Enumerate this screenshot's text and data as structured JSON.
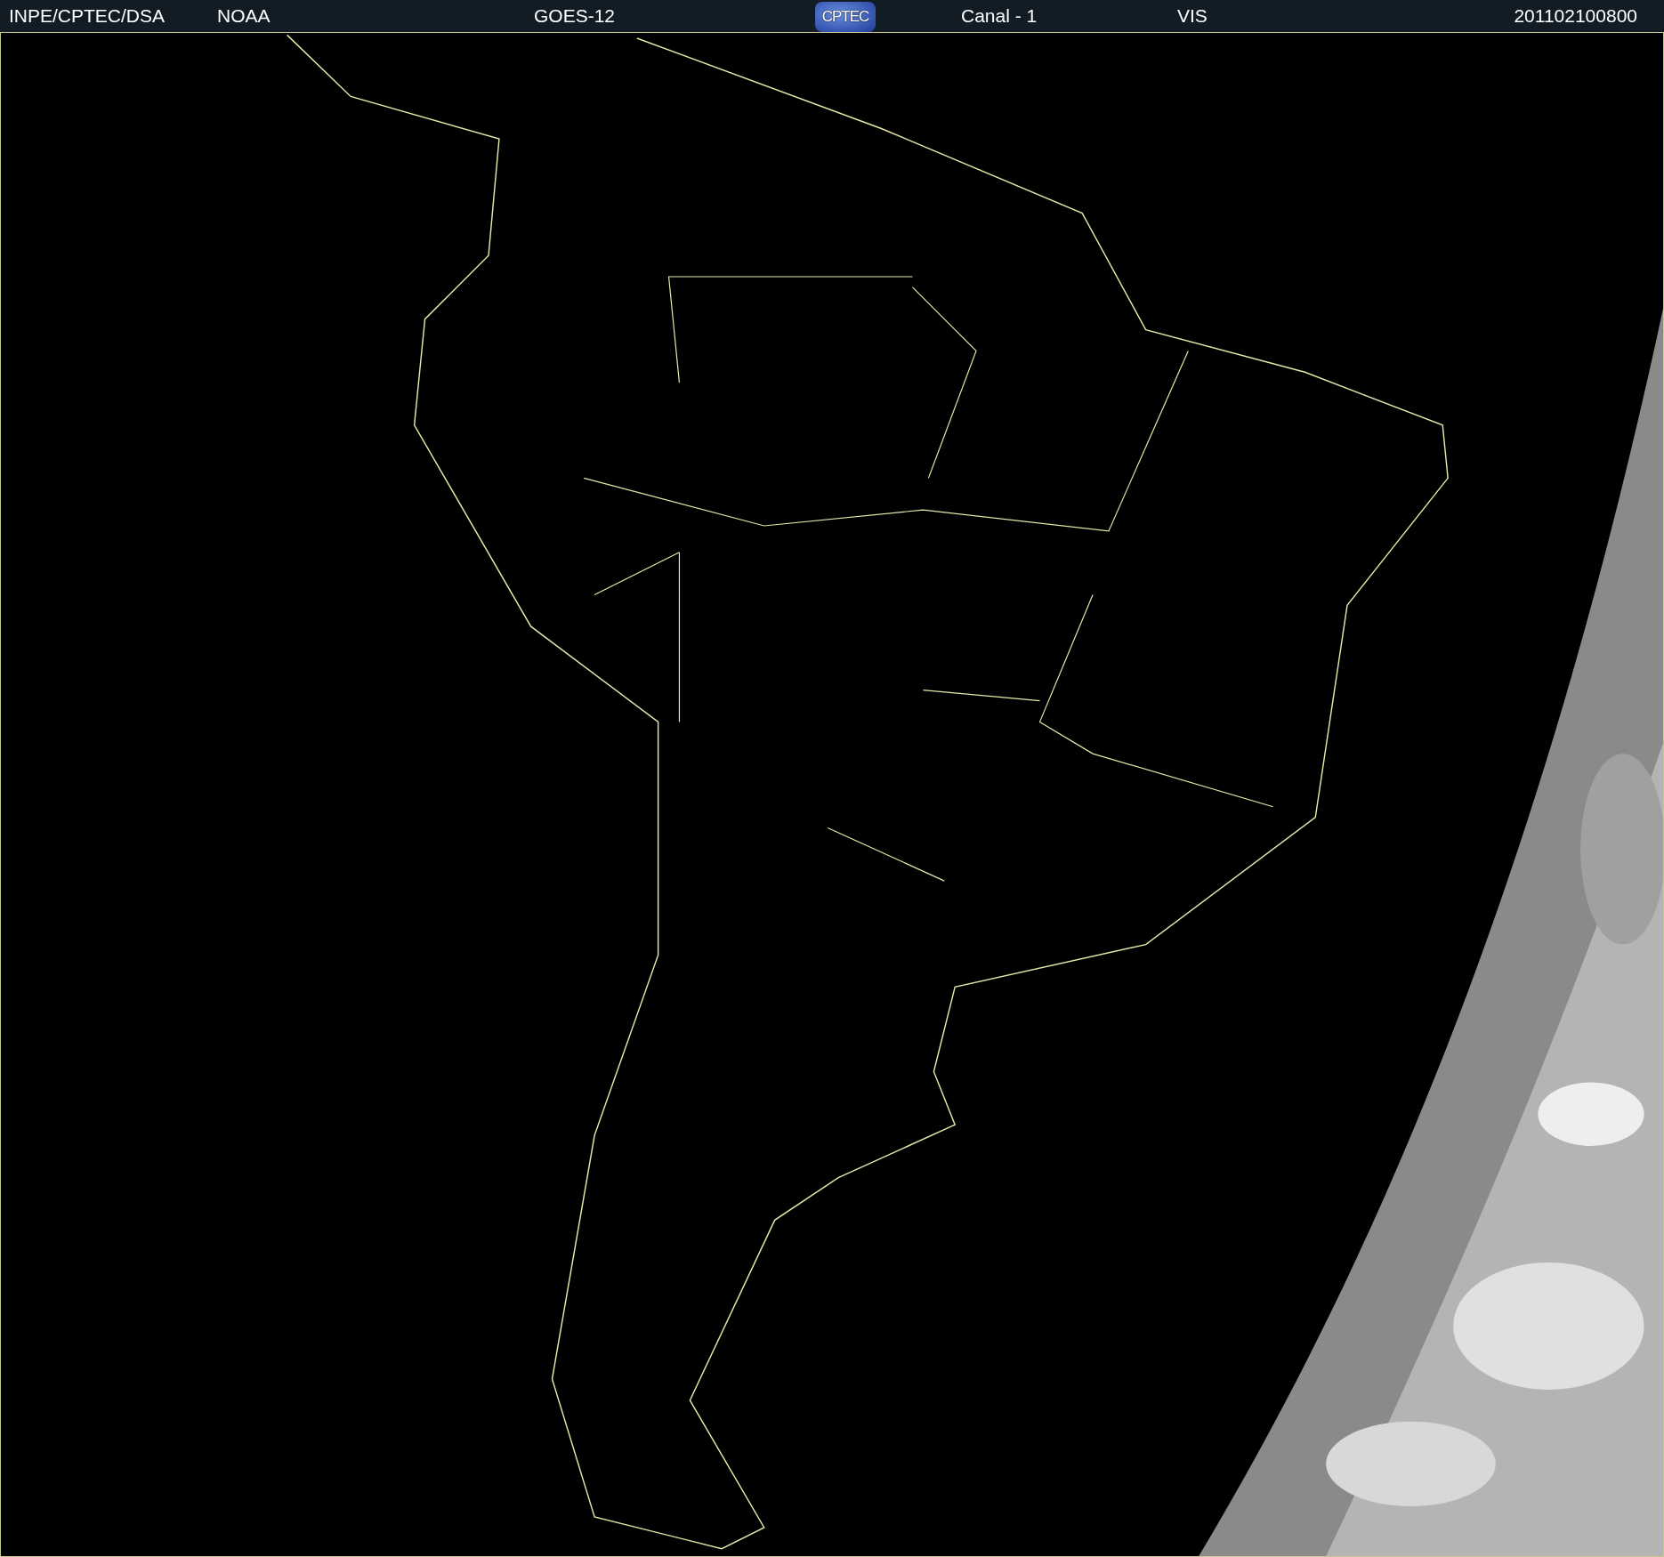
{
  "header": {
    "items": [
      {
        "kind": "text",
        "text": "INPE/CPTEC/DSA"
      },
      {
        "kind": "text",
        "text": "NOAA"
      },
      {
        "kind": "text",
        "text": "GOES-12"
      },
      {
        "kind": "logo",
        "text": "CPTEC"
      },
      {
        "kind": "text",
        "text": "Canal - 1"
      },
      {
        "kind": "text",
        "text": "VIS"
      },
      {
        "kind": "text",
        "text": "201102100800"
      }
    ]
  }
}
